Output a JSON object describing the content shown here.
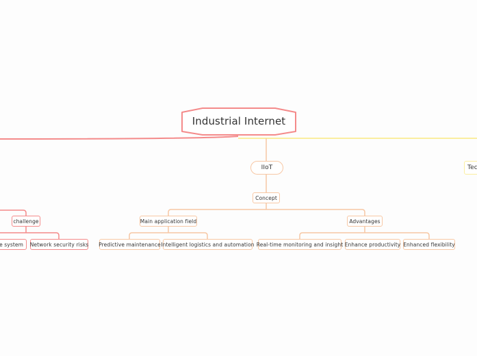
{
  "root": {
    "label": "Industrial Internet"
  },
  "branches": {
    "left": {
      "color": "#f48a8a"
    },
    "center": {
      "color": "#f7c7a4",
      "label": "IIoT",
      "concept": {
        "label": "Concept",
        "groups": [
          {
            "label": "Main application field",
            "children": [
              "Predictive maintenance",
              "Intelligent logistics and automation"
            ]
          },
          {
            "label": "Advantages",
            "children": [
              "Real-time monitoring and insight",
              "Enhance productivity",
              "Enhanced flexibility"
            ]
          }
        ]
      }
    },
    "right": {
      "color": "#fbee9f",
      "label_partial": "Tec"
    },
    "left_challenge": {
      "label": "challenge",
      "children": [
        "he system",
        "Network security risks"
      ]
    }
  }
}
